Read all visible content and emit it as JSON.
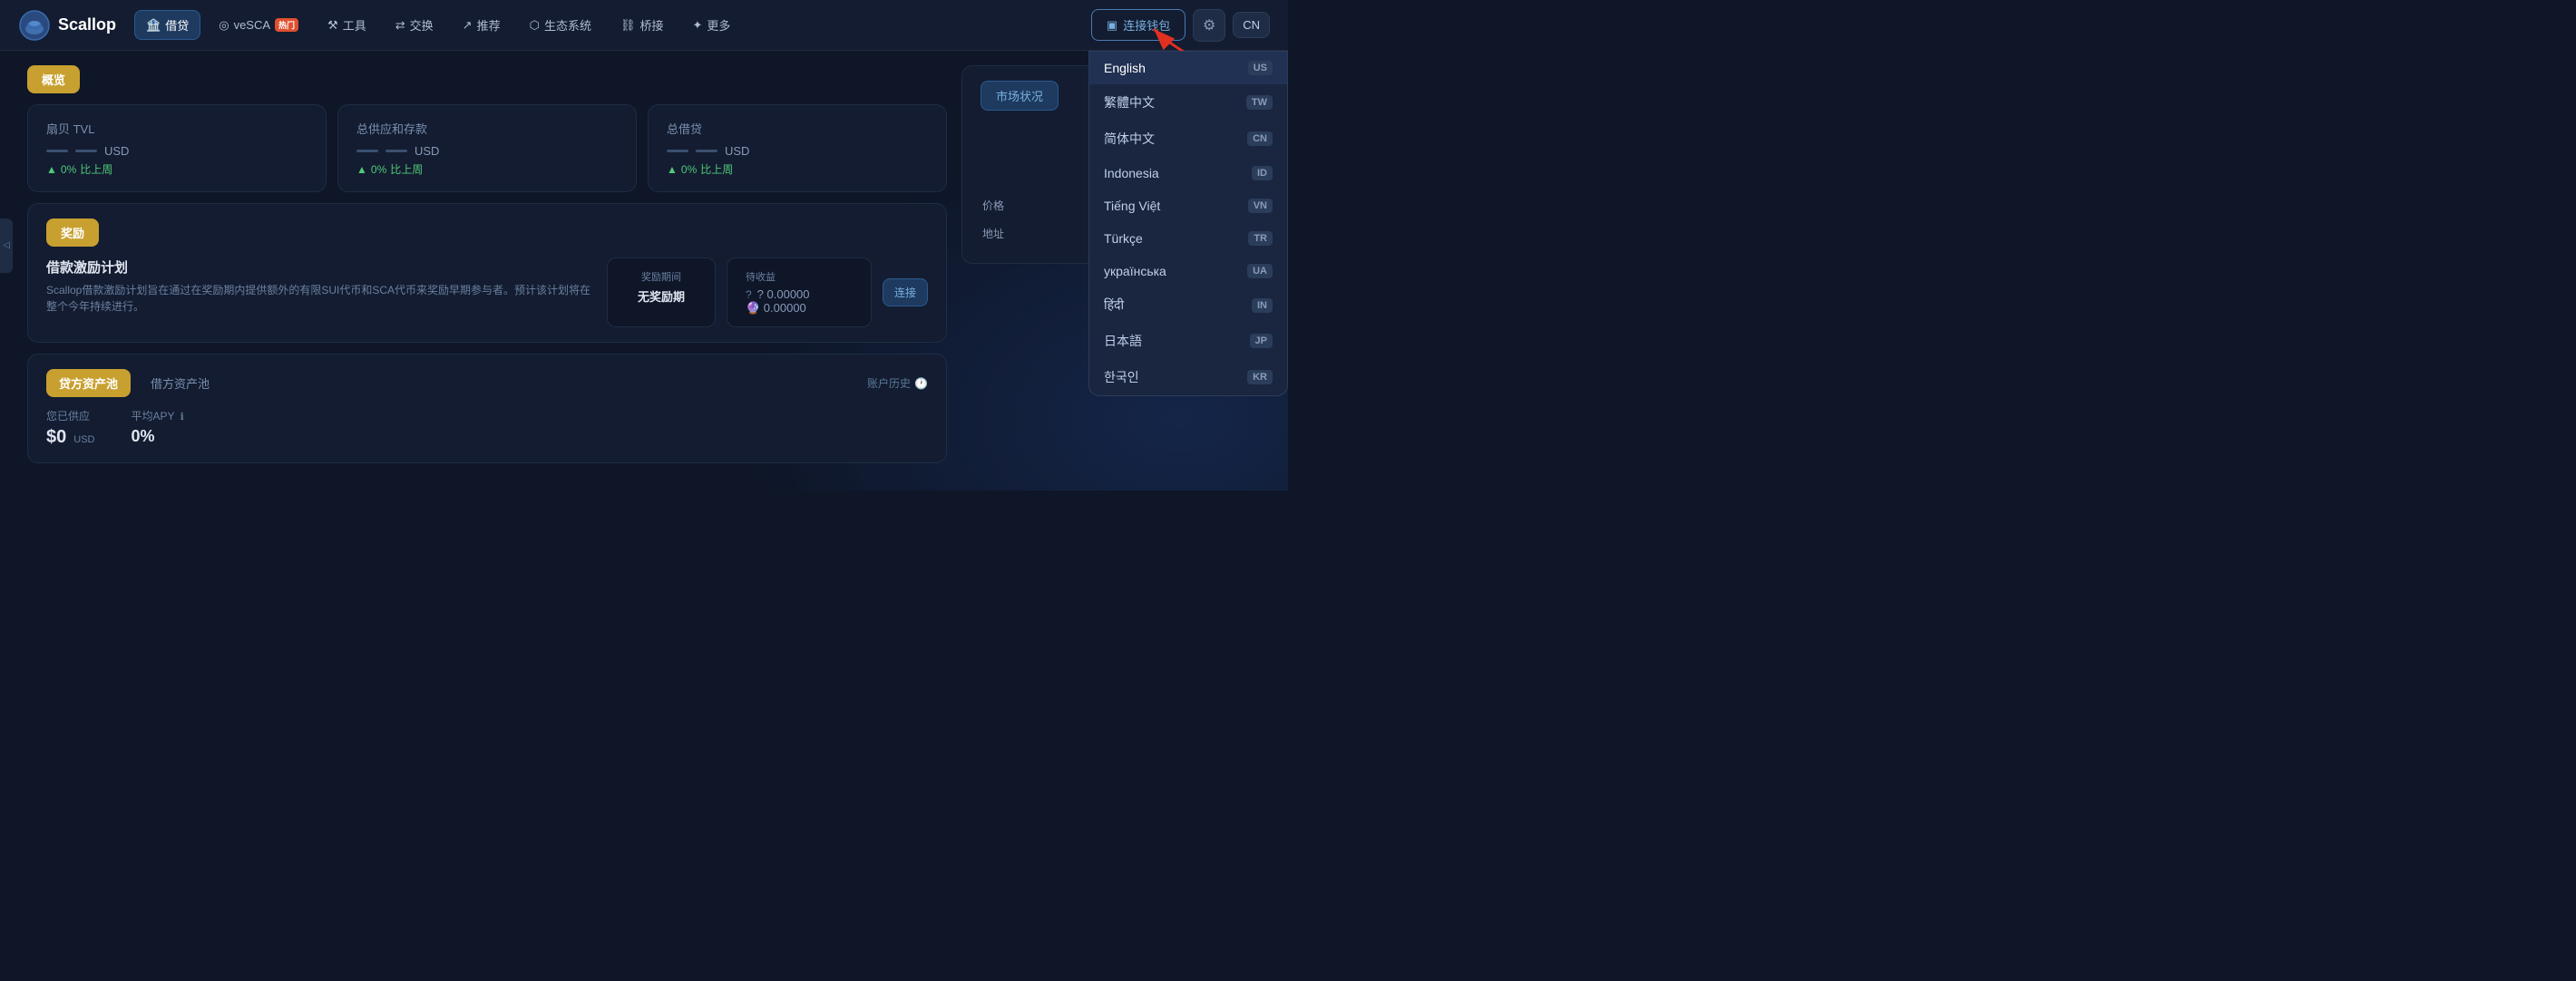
{
  "app": {
    "name": "Scallop",
    "logo_alt": "Scallop Logo"
  },
  "navbar": {
    "nav_items": [
      {
        "id": "lend",
        "label": "借贷",
        "icon": "🏦",
        "active": true,
        "hot": false
      },
      {
        "id": "vesca",
        "label": "veSCA",
        "icon": "◎",
        "active": false,
        "hot": true
      },
      {
        "id": "tools",
        "label": "工具",
        "icon": "⚒",
        "active": false,
        "hot": false
      },
      {
        "id": "swap",
        "label": "交换",
        "icon": "⇄",
        "active": false,
        "hot": false
      },
      {
        "id": "recommend",
        "label": "推荐",
        "icon": "↗",
        "active": false,
        "hot": false
      },
      {
        "id": "ecosystem",
        "label": "生态系统",
        "icon": "⬡",
        "active": false,
        "hot": false
      },
      {
        "id": "bridge",
        "label": "桥接",
        "icon": "⛓",
        "active": false,
        "hot": false
      },
      {
        "id": "more",
        "label": "更多",
        "icon": "✦",
        "active": false,
        "hot": false
      }
    ],
    "connect_wallet": "连接钱包",
    "language": "CN",
    "hot_label": "热门"
  },
  "overview": {
    "tab_label": "概览",
    "market_status_label": "市场状况",
    "tvl": {
      "label": "扇贝 TVL",
      "value": "——",
      "currency": "USD",
      "change": "0%",
      "change_label": "比上周"
    },
    "supply": {
      "label": "总供应和存款",
      "value": "——",
      "currency": "USD",
      "change": "0%",
      "change_label": "比上周"
    },
    "borrow": {
      "label": "总借贷",
      "value": "——",
      "currency": "USD",
      "change": "0%",
      "change_label": "比上周"
    }
  },
  "market": {
    "title": "市场状况",
    "price_label": "价格",
    "address_label": "地址",
    "question_mark": "?"
  },
  "incentive": {
    "tab_label": "奖励",
    "title": "借款激励计划",
    "description": "Scallop借款激励计划旨在通过在奖励期内提供额外的有限SUI代币和SCA代币来奖励早期参与者。预计该计划将在整个今年持续进行。",
    "reward_period_label": "奖励期间",
    "reward_period_value": "无奖励期",
    "pending_label": "待收益",
    "pending_value1": "? 0.00000",
    "pending_value2": "🔮 0.00000",
    "connect_label": "连接"
  },
  "pools": {
    "lend_tab": "贷方资产池",
    "borrow_tab": "借方资产池",
    "history_label": "账户历史",
    "supplied_label": "您已供应",
    "supplied_value": "$0",
    "supplied_currency": "USD",
    "avg_apy_label": "平均APY",
    "avg_apy_info": "ℹ",
    "avg_apy_value": "0%"
  },
  "language_menu": {
    "items": [
      {
        "id": "en",
        "label": "English",
        "flag": "US",
        "active": true
      },
      {
        "id": "zh-tw",
        "label": "繁體中文",
        "flag": "TW",
        "active": false
      },
      {
        "id": "zh-cn",
        "label": "简体中文",
        "flag": "CN",
        "active": false
      },
      {
        "id": "id",
        "label": "Indonesia",
        "flag": "ID",
        "active": false
      },
      {
        "id": "vi",
        "label": "Tiếng Việt",
        "flag": "VN",
        "active": false
      },
      {
        "id": "tr",
        "label": "Türkçe",
        "flag": "TR",
        "active": false
      },
      {
        "id": "uk",
        "label": "українська",
        "flag": "UA",
        "active": false
      },
      {
        "id": "hi",
        "label": "हिंदी",
        "flag": "IN",
        "active": false
      },
      {
        "id": "ja",
        "label": "日本語",
        "flag": "JP",
        "active": false
      },
      {
        "id": "ko",
        "label": "한국인",
        "flag": "KR",
        "active": false
      }
    ]
  }
}
